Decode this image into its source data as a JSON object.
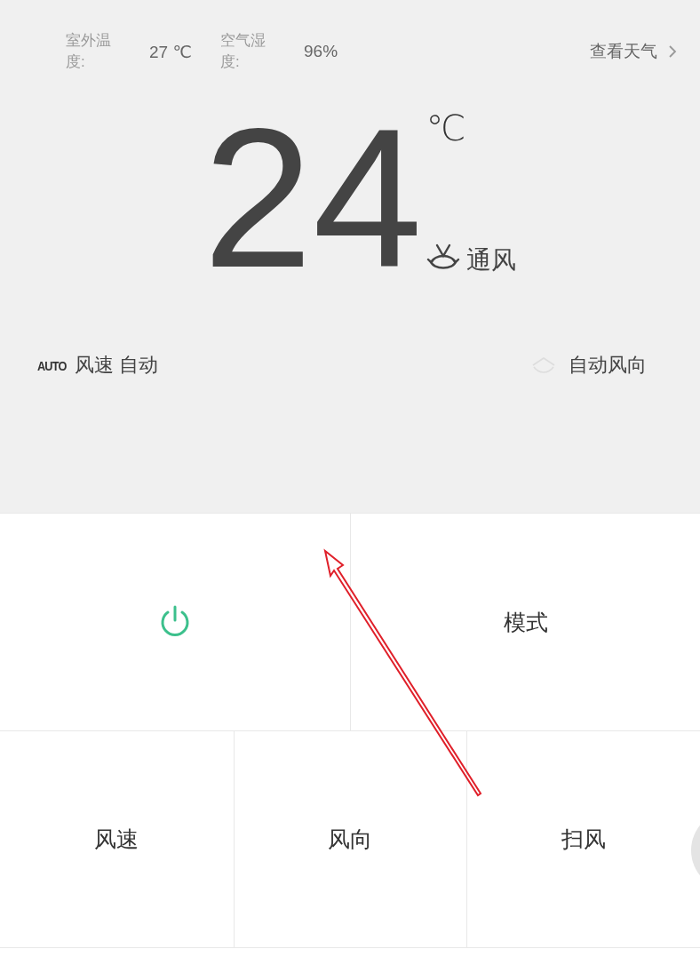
{
  "outdoor": {
    "temp_label": "室外温度:",
    "temp_value": "27 ℃",
    "humidity_label": "空气湿度:",
    "humidity_value": "96%",
    "weather_link": "查看天气"
  },
  "temperature": {
    "value": "24",
    "unit": "℃",
    "mode": "通风"
  },
  "status": {
    "fan_badge": "AUTO",
    "fan_speed": "风速 自动",
    "direction": "自动风向"
  },
  "control_rows": [
    [
      {
        "kind": "power",
        "on": true
      },
      {
        "kind": "label",
        "label": "模式"
      }
    ],
    [
      {
        "kind": "label",
        "label": "风速"
      },
      {
        "kind": "label",
        "label": "风向"
      },
      {
        "kind": "label",
        "label": "扫风"
      }
    ]
  ]
}
